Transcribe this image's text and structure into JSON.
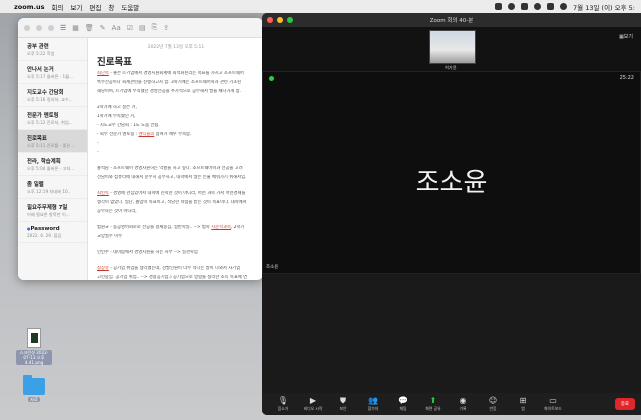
{
  "menubar": {
    "app": "zoom.us",
    "items": [
      "회의",
      "보기",
      "편집",
      "창",
      "도움말"
    ],
    "clock": "7월 13일 (이) 오후 5:"
  },
  "notes": {
    "list": [
      {
        "title": "공부 관련",
        "meta": "오후 5:22 학업"
      },
      {
        "title": "안나서 논거",
        "meta": "오후 5:17 올바른 - 1월..."
      },
      {
        "title": "지도교수 간담회",
        "meta": "오후 5:16 정리하, 교수..."
      },
      {
        "title": "전문가 멘토링",
        "meta": "오후 5:12 진로처, 취업..."
      },
      {
        "title": "진로목표",
        "meta": "오후 5:11 진로를 - 좋은..."
      },
      {
        "title": "전라, 학습계획",
        "meta": "오후 5:04 올바른 - 고처..."
      },
      {
        "title": "좀 일렬",
        "meta": "오후 12:19 지네봐 10.."
      },
      {
        "title": "필요주무제형 7일",
        "meta": "어제 필요한 항목만 이..."
      },
      {
        "title": "Password",
        "meta": "2022. 6. 29. 잠김"
      }
    ],
    "date": "2022년 7월 13일 오후 5:11",
    "title": "진로목표",
    "paragraphs": [
      {
        "pre": "",
        "hl": "최단목",
        "post": " - 좋은 IT기업에서 경영지원회계에 최적화된리는 목표를 가지고 소프트웨어"
      },
      {
        "pre": "특수전공이나 회계관련을 진행하고자 함. 3학기에는 소프트웨어학과 관련 기초된",
        "hl": "",
        "post": ""
      },
      {
        "pre": "해당이며, IT기업에 부족했던 경영전공을 추가적으로 공부해서 발을 채나가게 함.",
        "hl": "",
        "post": ""
      },
      {
        "pre": "2학기에 하고 싶은 거,",
        "hl": "",
        "post": ""
      },
      {
        "pre": "1학기에 부족했던 거,",
        "hl": "",
        "post": ""
      },
      {
        "pre": " - 지도교수 간담회 : 1도 도움 안됨.",
        "hl": "",
        "post": ""
      },
      {
        "pre": " - 회부 전문가 멘토링 : ",
        "hl": "멘티들의",
        "post": " 참여가 매우 부족함."
      },
      {
        "pre": " - ",
        "hl": "",
        "post": ""
      },
      {
        "pre": " - ",
        "hl": "",
        "post": ""
      },
      {
        "pre": "홍석담 - 소프트웨어 경영자원하는 역할을 하고 싶다. 소프트웨어학과 전공을 고려",
        "hl": "",
        "post": ""
      },
      {
        "pre": "전담이와 컴퓨터에 대해서 순수히 공부하고, 대학에서 많은 인물 배워가기 위해서입.",
        "hl": "",
        "post": ""
      },
      {
        "pre": "",
        "hl": "최빈목",
        "post": " - 경영에 관심있어서 대학에 진학한 것이 아니라, 어떤 과목 가서 어떤경제를"
      },
      {
        "pre": "생각이 없었다. 일단, 졸업이 목표이고, 적당한 학점을 받는 것이 목표이다. 대학에서",
        "hl": "",
        "post": ""
      },
      {
        "pre": "공부하는 것이 아니라,",
        "hl": "",
        "post": ""
      },
      {
        "pre": "법원교 - 통공영어회로로 전공을 결제중심, 일반학일.. --> 법학 ",
        "hl": "지문학과목",
        "post": ", 2학기"
      },
      {
        "pre": "교양필수 이수",
        "hl": "",
        "post": ""
      },
      {
        "pre": "인턴주 - 데이탑에서 경영지원을 하는 자무 --> 일관학업",
        "hl": "",
        "post": ""
      },
      {
        "pre": "",
        "hl": "정상유",
        "post": " - 공기업 취업을 생각했는데, 선발인원이 너무 적다는 말이 나와서 사기업"
      },
      {
        "pre": "고민중임. 공기업 취업.. --> 경용공기업.) 공기업으로 방향을 정리한 소득 목표에 연",
        "hl": "",
        "post": ""
      },
      {
        "pre": "",
        "hl": "조소윤",
        "post": " - 소학 연과, 복전을 고려하는 이유 : 경영이랑 안 맞아서, 공대를 고려하는지"
      },
      {
        "pre": "알아나 할 맞지 않는 것 같아서. /",
        "hl": "",
        "post": ""
      }
    ]
  },
  "zoom": {
    "window_title": "Zoom 회의 40-분",
    "view_label": "보기",
    "thumbnail_name": "허가윤",
    "timer": "25:22",
    "speaker_name": "조소윤",
    "tile_label": "조소윤",
    "controls": [
      {
        "icon": "microphone-icon",
        "glyph": "🎙",
        "label": "음소거",
        "green": false
      },
      {
        "icon": "video-icon",
        "glyph": "▶",
        "label": "비디오 시작",
        "green": false
      },
      {
        "icon": "security-icon",
        "glyph": "⛊",
        "label": "보안",
        "green": false
      },
      {
        "icon": "participants-icon",
        "glyph": "👥",
        "label": "참가자",
        "green": false
      },
      {
        "icon": "chat-icon",
        "glyph": "💬",
        "label": "채팅",
        "green": false
      },
      {
        "icon": "share-screen-icon",
        "glyph": "⬆",
        "label": "화면 공유",
        "green": true
      },
      {
        "icon": "record-icon",
        "glyph": "◉",
        "label": "기록",
        "green": false
      },
      {
        "icon": "reactions-icon",
        "glyph": "☺",
        "label": "반응",
        "green": false
      },
      {
        "icon": "apps-icon",
        "glyph": "⊞",
        "label": "앱",
        "green": false
      },
      {
        "icon": "whiteboard-icon",
        "glyph": "▭",
        "label": "화이트보드",
        "green": false
      }
    ],
    "leave_label": "종료"
  },
  "desktop": {
    "file_label": "스크린샷 2022-07-13 오후 4.41.png",
    "folder_label": "자료"
  }
}
